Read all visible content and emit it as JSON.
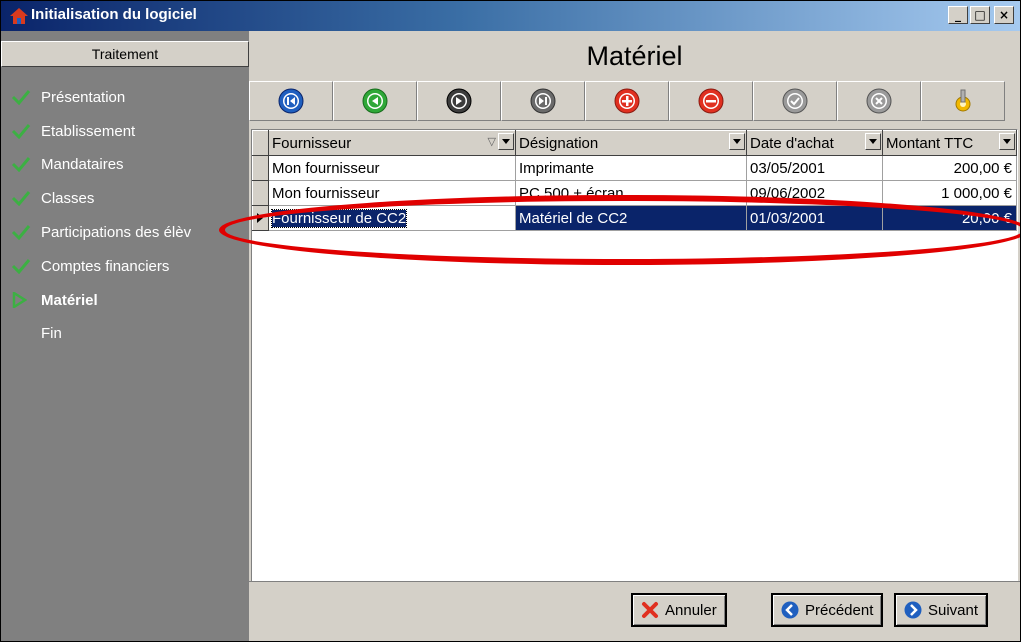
{
  "window": {
    "title": "Initialisation du logiciel",
    "min": "_",
    "max": "□",
    "close": "×"
  },
  "sidebar": {
    "header": "Traitement",
    "items": [
      {
        "label": "Présentation",
        "state": "done"
      },
      {
        "label": "Etablissement",
        "state": "done"
      },
      {
        "label": "Mandataires",
        "state": "done"
      },
      {
        "label": "Classes",
        "state": "done"
      },
      {
        "label": "Participations des élèv",
        "state": "done"
      },
      {
        "label": "Comptes financiers",
        "state": "done"
      },
      {
        "label": "Matériel",
        "state": "current"
      },
      {
        "label": "Fin",
        "state": "pending"
      }
    ]
  },
  "main": {
    "title": "Matériel"
  },
  "navbar": {
    "buttons": [
      {
        "icon": "first-record-icon"
      },
      {
        "icon": "previous-record-icon"
      },
      {
        "icon": "next-record-icon"
      },
      {
        "icon": "last-record-icon"
      },
      {
        "icon": "add-record-icon"
      },
      {
        "icon": "delete-record-icon"
      },
      {
        "icon": "validate-icon"
      },
      {
        "icon": "cancel-edit-icon"
      },
      {
        "icon": "settings-icon"
      }
    ]
  },
  "grid": {
    "columns": [
      "Fournisseur",
      "Désignation",
      "Date d'achat",
      "Montant TTC"
    ],
    "rows": [
      [
        "Mon fournisseur",
        "Imprimante",
        "03/05/2001",
        "200,00 €"
      ],
      [
        "Mon fournisseur",
        "PC 500 + écran",
        "09/06/2002",
        "1 000,00 €"
      ],
      [
        "Fournisseur de CC2",
        "Matériel de CC2",
        "01/03/2001",
        "20,00 €"
      ]
    ],
    "selected_row": 2
  },
  "footer": {
    "cancel": "Annuler",
    "previous": "Précédent",
    "next": "Suivant"
  },
  "colors": {
    "selection": "#0a246a",
    "annotation": "#e00000",
    "check": "#3cb043"
  }
}
